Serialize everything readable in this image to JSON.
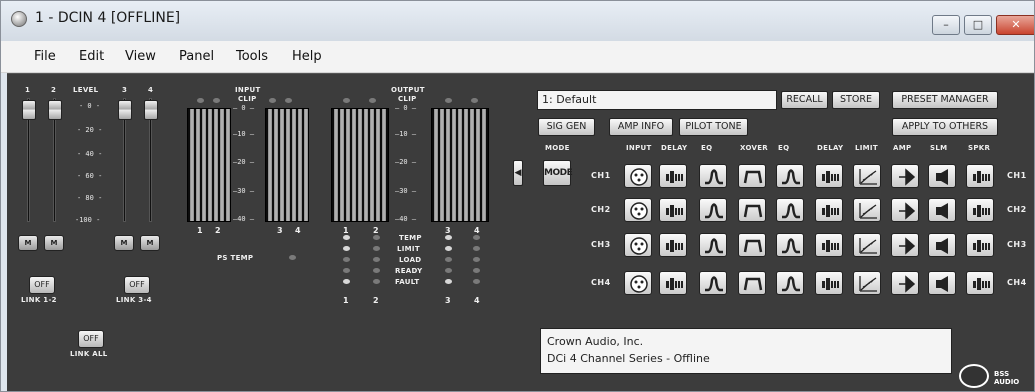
{
  "window": {
    "title": "1 - DCIN 4 [OFFLINE]",
    "min_label": "–",
    "max_label": "□",
    "close_label": "✕"
  },
  "menu": [
    "File",
    "Edit",
    "View",
    "Panel",
    "Tools",
    "Help"
  ],
  "faders": {
    "ch1": "1",
    "ch2": "2",
    "level": "LEVEL",
    "ch3": "3",
    "ch4": "4",
    "scale": [
      "- 0 -",
      "- 20 -",
      "- 40 -",
      "- 60 -",
      "- 80 -",
      "-100 -"
    ],
    "mute_label": "M",
    "link12_btn": "OFF",
    "link12_label": "LINK 1-2",
    "link34_btn": "OFF",
    "link34_label": "LINK 3-4",
    "linkall_btn": "OFF",
    "linkall_label": "LINK ALL"
  },
  "input_meter": {
    "title_line1": "INPUT",
    "title_line2": "CLIP",
    "scale": [
      "— 0 —",
      "—10 —",
      "—20 —",
      "—30 —",
      "—40 —"
    ],
    "ch_labels": [
      "1",
      "2",
      "3",
      "4"
    ],
    "ps_temp": "PS TEMP"
  },
  "output_meter": {
    "title_line1": "OUTPUT",
    "title_line2": "CLIP",
    "scale": [
      "— 0 —",
      "—10 —",
      "—20 —",
      "—30 —",
      "—40 —"
    ],
    "ch_labels_top": [
      "1",
      "2",
      "3",
      "4"
    ],
    "ch_labels_bottom": [
      "1",
      "2",
      "3",
      "4"
    ],
    "status": [
      "TEMP",
      "LIMIT",
      "LOAD",
      "READY",
      "FAULT"
    ]
  },
  "preset": {
    "current": "1: Default",
    "recall": "RECALL",
    "store": "STORE",
    "manager": "PRESET MANAGER",
    "sig_gen": "SIG GEN",
    "amp_info": "AMP INFO",
    "pilot_tone": "PILOT TONE",
    "apply_others": "APPLY TO OTHERS"
  },
  "dsp": {
    "mode_label": "MODE",
    "mode_btn": "MODE",
    "columns": [
      "INPUT",
      "DELAY",
      "EQ",
      "XOVER",
      "EQ",
      "DELAY",
      "LIMIT",
      "AMP",
      "SLM",
      "SPKR"
    ],
    "channels": [
      "CH1",
      "CH2",
      "CH3",
      "CH4"
    ],
    "icons": [
      "input-xlr-icon",
      "delay-icon",
      "eq-bell-icon",
      "xover-icon",
      "eq-bell-icon",
      "delay-icon",
      "limiter-icon",
      "amp-icon",
      "slm-speaker-icon",
      "speaker-icon"
    ]
  },
  "info": {
    "line1": "Crown Audio, Inc.",
    "line2": "DCi 4 Channel Series - Offline"
  },
  "logo": {
    "text": "BSS AUDIO"
  }
}
